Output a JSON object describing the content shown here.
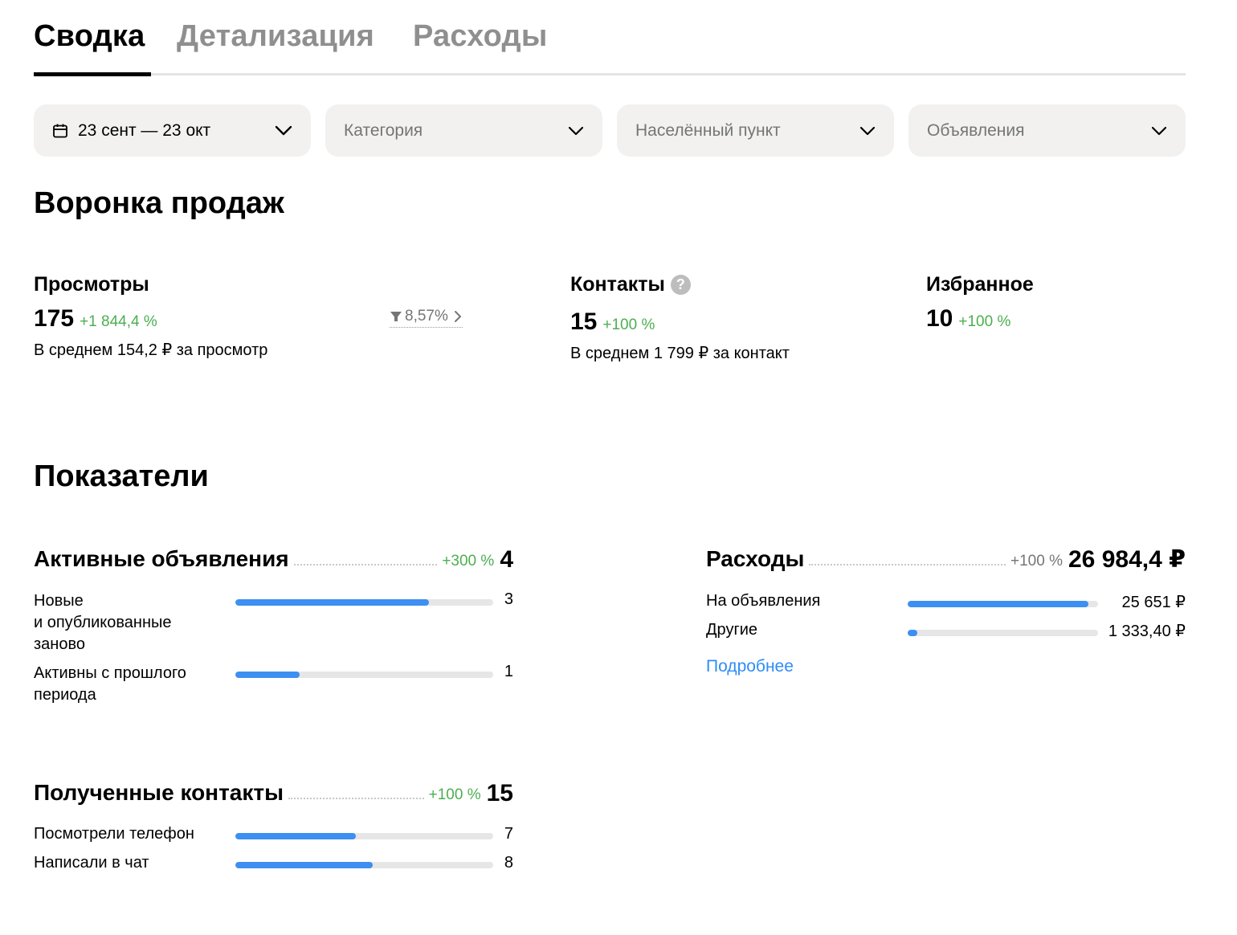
{
  "tabs": [
    {
      "label": "Сводка",
      "active": true
    },
    {
      "label": "Детализация",
      "active": false
    },
    {
      "label": "Расходы",
      "active": false
    }
  ],
  "filters": {
    "period": {
      "label": "23 сент — 23 окт",
      "icon": "calendar-icon"
    },
    "category": {
      "placeholder": "Категория"
    },
    "locality": {
      "placeholder": "Населённый пункт"
    },
    "ads": {
      "placeholder": "Объявления"
    }
  },
  "funnel": {
    "title": "Воронка продаж",
    "views": {
      "label": "Просмотры",
      "value": "175",
      "change": "+1 844,4 %",
      "average": "В среднем 154,2 ₽ за просмотр",
      "conversion": "8,57%"
    },
    "contacts": {
      "label": "Контакты",
      "help": "?",
      "value": "15",
      "change": "+100 %",
      "average": "В среднем 1 799 ₽ за контакт"
    },
    "favorites": {
      "label": "Избранное",
      "value": "10",
      "change": "+100 %"
    }
  },
  "metrics": {
    "title": "Показатели",
    "active_ads": {
      "title": "Активные объявления",
      "change": "+300 %",
      "total": "4",
      "rows": [
        {
          "label_lines": [
            "Новые",
            "и опубликованные",
            "заново"
          ],
          "value": "3",
          "fraction": 0.75
        },
        {
          "label_lines": [
            "Активны с прошлого",
            "периода"
          ],
          "value": "1",
          "fraction": 0.25
        }
      ]
    },
    "expenses": {
      "title": "Расходы",
      "change": "+100 %",
      "total": "26 984,4 ₽",
      "rows": [
        {
          "label": "На объявления",
          "value": "25 651 ₽",
          "fraction": 0.95
        },
        {
          "label": "Другие",
          "value": "1 333,40 ₽",
          "fraction": 0.05
        }
      ],
      "more_link": "Подробнее"
    },
    "contacts": {
      "title": "Полученные контакты",
      "change": "+100 %",
      "total": "15",
      "rows": [
        {
          "label": "Посмотрели телефон",
          "value": "7",
          "fraction": 0.467
        },
        {
          "label": "Написали в чат",
          "value": "8",
          "fraction": 0.533
        }
      ]
    }
  },
  "colors": {
    "accent": "#3d8ff1",
    "positive": "#4caf50",
    "filter_bg": "#f2f1f0",
    "link": "#2f8df5"
  }
}
